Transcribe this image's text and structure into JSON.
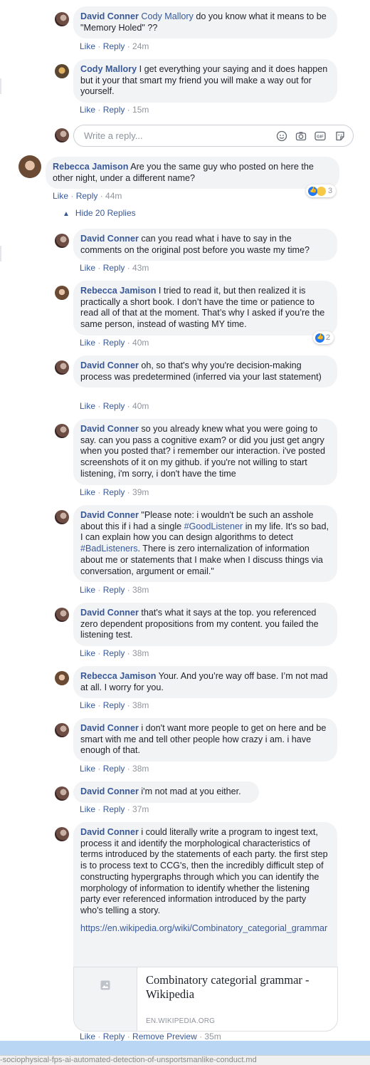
{
  "comments": {
    "c1": {
      "author": "David Conner",
      "mention": "Cody Mallory",
      "text": " do you know what it means to be \"Memory Holed\" ??",
      "like": "Like",
      "reply": "Reply",
      "time": "24m"
    },
    "c2": {
      "author": "Cody Mallory",
      "text": " I get everything your saying and it does happen but it your that smart my friend you will make a way out for yourself.",
      "like": "Like",
      "reply": "Reply",
      "time": "15m"
    },
    "reply_box": {
      "placeholder": "Write a reply..."
    },
    "c3": {
      "author": "Rebecca Jamison",
      "text": " Are you the same guy who posted on here the other night, under a different name?",
      "like": "Like",
      "reply": "Reply",
      "time": "44m",
      "reaction_count": "3"
    },
    "toggle": {
      "label": "Hide 20 Replies"
    },
    "c4": {
      "author": "David Conner",
      "text": " can you read what i have to say in the comments on the original post before you waste my time?",
      "like": "Like",
      "reply": "Reply",
      "time": "43m"
    },
    "c5": {
      "author": "Rebecca Jamison",
      "text": " I tried to read it, but then realized it is practically a short book. I don’t have the time or patience to read all of that at the moment. That’s why I asked if you’re the same person, instead of wasting MY time.",
      "like": "Like",
      "reply": "Reply",
      "time": "40m",
      "reaction_count": "2"
    },
    "c6": {
      "author": "David Conner",
      "text": " oh, so that's why you're decision-making process was predetermined (inferred via your last statement)",
      "like": "Like",
      "reply": "Reply",
      "time": "40m"
    },
    "c7": {
      "author": "David Conner",
      "text": " so you already knew what you were going to say. can you pass a cognitive exam? or did you just get angry when you posted that? i remember our interaction. i've posted screenshots of it on my github. if you're not willing to start listening, i'm sorry, i don't have the time",
      "like": "Like",
      "reply": "Reply",
      "time": "39m"
    },
    "c8": {
      "author": "David Conner",
      "text_a": " \"Please note: i wouldn't be such an asshole about this if i had a single ",
      "tag1": "#GoodListener",
      "text_b": " in my life. It's so bad, I can explain how you can design algorithms to detect ",
      "tag2": "#BadListeners",
      "text_c": ". There is zero internalization of information about me or statements that I make when I discuss things via conversation, argument or email.\"",
      "like": "Like",
      "reply": "Reply",
      "time": "38m"
    },
    "c9": {
      "author": "David Conner",
      "text": " that's what it says at the top. you referenced zero dependent propositions from my content. you failed the listening test.",
      "like": "Like",
      "reply": "Reply",
      "time": "38m"
    },
    "c10": {
      "author": "Rebecca Jamison",
      "text": " Your. And you’re way off base. I’m not mad at all. I worry for you.",
      "like": "Like",
      "reply": "Reply",
      "time": "38m"
    },
    "c11": {
      "author": "David Conner",
      "text": " i don't want more people to get on here and be smart with me and tell other people how crazy i am. i have enough of that.",
      "like": "Like",
      "reply": "Reply",
      "time": "38m"
    },
    "c12": {
      "author": "David Conner",
      "text": " i'm not mad at you either.",
      "like": "Like",
      "reply": "Reply",
      "time": "37m"
    },
    "c13": {
      "author": "David Conner",
      "text": " i could literally write a program to ingest text, process it and identify the morphological characteristics of terms introduced by the statements of each party. the first step is to process text to CCG's, then the incredibly difficult step of constructing hypergraphs through which you can identify the morphology of information to identify whether the listening party ever referenced information introduced by the party who's telling a story.",
      "link": "https://en.wikipedia.org/wiki/Combinatory_categorial_grammar",
      "like": "Like",
      "reply": "Reply",
      "remove": "Remove Preview",
      "time": "35m"
    },
    "preview": {
      "title": "Combinatory categorial grammar - Wikipedia",
      "domain": "EN.WIKIPEDIA.ORG"
    }
  },
  "status_bar": {
    "text": "-sociophysical-fps-ai-automated-detection-of-unsportsmanlike-conduct.md"
  }
}
